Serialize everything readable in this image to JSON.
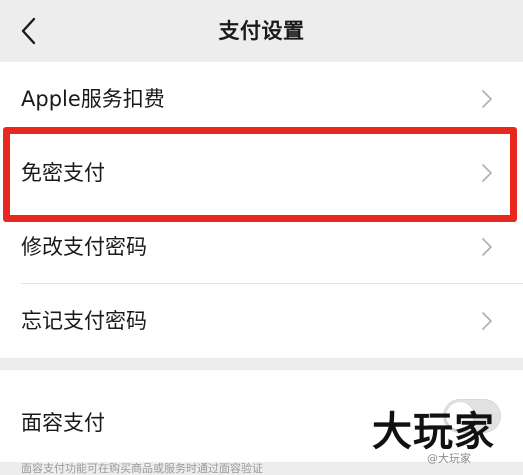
{
  "nav": {
    "title": "支付设置",
    "back_icon": "chevron-left-icon"
  },
  "group1": {
    "items": [
      {
        "label": "Apple服务扣费",
        "icon": "chevron-right-icon"
      },
      {
        "label": "免密支付",
        "icon": "chevron-right-icon",
        "highlighted": true
      },
      {
        "label": "修改支付密码",
        "icon": "chevron-right-icon"
      },
      {
        "label": "忘记支付密码",
        "icon": "chevron-right-icon"
      }
    ]
  },
  "group2": {
    "items": [
      {
        "label": "面容支付",
        "toggle_on": false
      }
    ]
  },
  "footer": {
    "note": "面容支付功能可在购买商品或服务时通过面容验证"
  },
  "watermark": {
    "logo": "大玩家",
    "small": "@大玩家"
  },
  "colors": {
    "highlight": "#e8281e",
    "background": "#ededed",
    "surface": "#ffffff"
  }
}
